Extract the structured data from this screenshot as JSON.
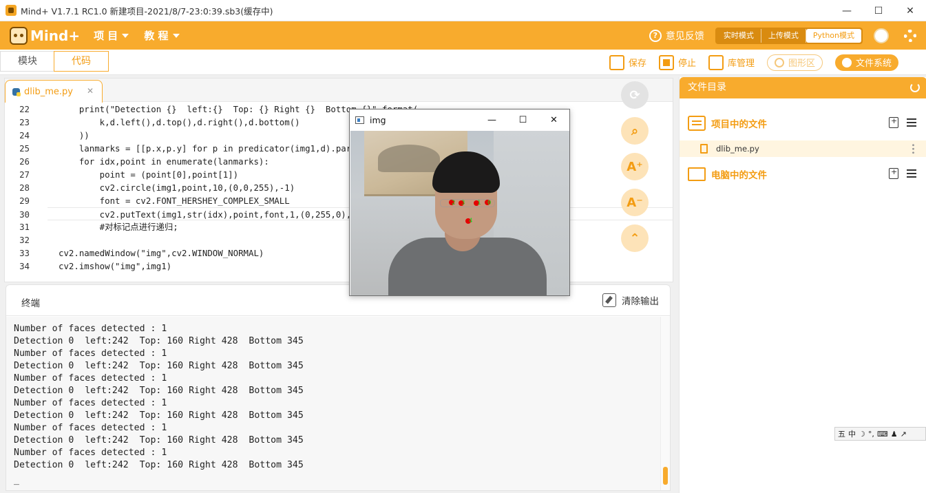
{
  "window": {
    "title": "Mind+ V1.7.1 RC1.0   新建项目-2021/8/7-23:0:39.sb3(缓存中)",
    "minimize": "—",
    "maximize": "☐",
    "close": "✕"
  },
  "topbar": {
    "brand": "Mind+",
    "menu": [
      "项 目",
      "教 程"
    ],
    "feedback": "意见反馈",
    "modes": [
      "实时模式",
      "上传模式",
      "Python模式"
    ],
    "active_mode": "Python模式"
  },
  "toolbar": {
    "view_tabs": [
      "模块",
      "代码"
    ],
    "active_view": "代码",
    "save": "保存",
    "stop": "停止",
    "library": "库管理",
    "graphics": "图形区",
    "filesystem": "文件系统"
  },
  "editor": {
    "file_tab": "dlib_me.py",
    "file_tab_close": "✕",
    "lines": [
      {
        "n": "22",
        "text": "    print(\"Detection {}  left:{}  Top: {} Right {}  Bottom {}\".format("
      },
      {
        "n": "23",
        "text": "        k,d.left(),d.top(),d.right(),d.bottom()"
      },
      {
        "n": "24",
        "text": "    ))"
      },
      {
        "n": "25",
        "text": "    lanmarks = [[p.x,p.y] for p in predicator(img1,d).parts()]"
      },
      {
        "n": "26",
        "text": "    for idx,point in enumerate(lanmarks):"
      },
      {
        "n": "27",
        "text": "        point = (point[0],point[1])"
      },
      {
        "n": "28",
        "text": "        cv2.circle(img1,point,10,(0,0,255),-1)"
      },
      {
        "n": "29",
        "text": "        font = cv2.FONT_HERSHEY_COMPLEX_SMALL"
      },
      {
        "n": "30",
        "text": "        cv2.putText(img1,str(idx),point,font,1,(0,255,0),1,cv2.LINE_AA)"
      },
      {
        "n": "31",
        "text": "        #对标记点进行递归;"
      },
      {
        "n": "32",
        "text": ""
      },
      {
        "n": "33",
        "text": "cv2.namedWindow(\"img\",cv2.WINDOW_NORMAL)"
      },
      {
        "n": "34",
        "text": "cv2.imshow(\"img\",img1)"
      }
    ]
  },
  "floating_tools": [
    "⟳",
    "⌕",
    "A⁺",
    "A⁻",
    "⌃"
  ],
  "terminal": {
    "title": "终端",
    "clear": "清除输出",
    "lines": [
      "Number of faces detected : 1",
      "Detection 0  left:242  Top: 160 Right 428  Bottom 345",
      "Number of faces detected : 1",
      "Detection 0  left:242  Top: 160 Right 428  Bottom 345",
      "Number of faces detected : 1",
      "Detection 0  left:242  Top: 160 Right 428  Bottom 345",
      "Number of faces detected : 1",
      "Detection 0  left:242  Top: 160 Right 428  Bottom 345",
      "Number of faces detected : 1",
      "Detection 0  left:242  Top: 160 Right 428  Bottom 345",
      "Number of faces detected : 1",
      "Detection 0  left:242  Top: 160 Right 428  Bottom 345",
      "_"
    ]
  },
  "files": {
    "header": "文件目录",
    "project_section": "项目中的文件",
    "project_file": "dlib_me.py",
    "computer_section": "电脑中的文件"
  },
  "ime": [
    "五",
    "中",
    "☽",
    "°,",
    "⌨",
    "♟",
    "↗"
  ],
  "img_window": {
    "title": "img",
    "minimize": "—",
    "maximize": "☐",
    "close": "✕",
    "landmark_labels": [
      "2",
      "3",
      "1",
      "0",
      "4"
    ]
  },
  "colors": {
    "accent": "#f8ab2d",
    "accent_text": "#f39c12"
  }
}
